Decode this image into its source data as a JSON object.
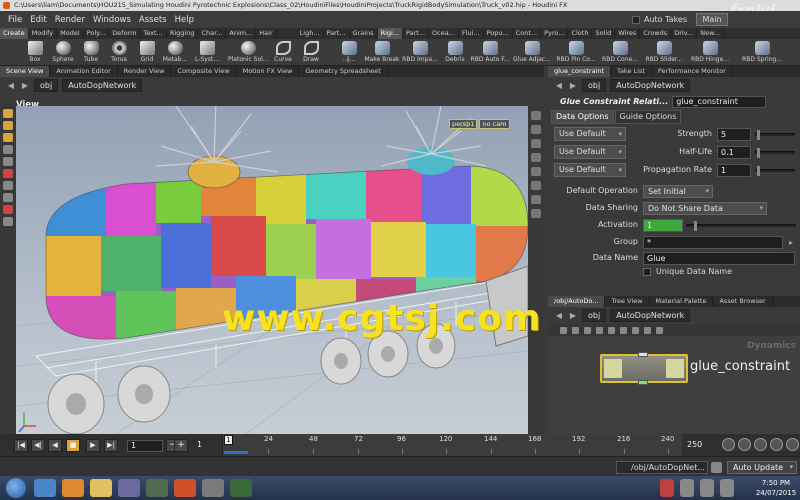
{
  "window": {
    "title": "C:\\Users\\liam\\Documents\\HOU215_Simulating Houdini Pyrotechnic Explosions\\Class_02\\HoudiniFiles\\HoudiniProjects\\TruckRigidBodySimulation\\Truck_v02.hip - Houdini FX",
    "watermark_logo": "fxphd"
  },
  "menubar": {
    "items": [
      "File",
      "Edit",
      "Render",
      "Windows",
      "Assets",
      "Help"
    ],
    "auto_takes": "Auto Takes",
    "desktop": "Main"
  },
  "shelf": {
    "left_tabs": [
      "Create",
      "Modify",
      "Model",
      "Poly...",
      "Deform",
      "Text...",
      "Rigging",
      "Char...",
      "Anim...",
      "Hair"
    ],
    "right_tabs": [
      "Ligh...",
      "Part...",
      "Grains",
      "Rigi...",
      "Part...",
      "Ocea...",
      "Flui...",
      "Popu...",
      "Cont...",
      "Pyro...",
      "Cloth",
      "Solid",
      "Wires",
      "Crowds",
      "Driv...",
      "New..."
    ],
    "left_tools": [
      "Box",
      "Sphere",
      "Tube",
      "Torus",
      "Grid",
      "Metab...",
      "L-Syst...",
      "Platonic Sol...",
      "Curve",
      "Draw"
    ],
    "right_tools": [
      "..ij...",
      "Make Break",
      "RBD Impa...",
      "Debris",
      "RBD Auto F...",
      "Glue Adjac...",
      "RBD Pin Co...",
      "RBD Cone...",
      "RBD Slider...",
      "RBD Hinge...",
      "RBD Spring..."
    ]
  },
  "viewer": {
    "tabs": [
      "Scene View",
      "Animation Editor",
      "Render View",
      "Composite View",
      "Motion FX View",
      "Geometry Spreadsheet"
    ],
    "path": [
      "obj",
      "AutoDopNetwork"
    ],
    "view_name": "View",
    "camera": "persp1",
    "cam_mode": "no cam",
    "watermark": "www.cgtsj.com"
  },
  "params": {
    "tabs": [
      "glue_constraint",
      "Take List",
      "Performance Monitor"
    ],
    "path": [
      "obj",
      "AutoDopNetwork"
    ],
    "node_type": "Glue Constraint Relati...",
    "node_name": "glue_constraint",
    "subtabs": [
      "Data Options",
      "Guide Options"
    ],
    "use_default": "Use Default",
    "strength_label": "Strength",
    "strength": "5",
    "halflife_label": "Half-Life",
    "halflife": "0.1",
    "propagation_label": "Propagation Rate",
    "propagation": "1",
    "default_op_label": "Default Operation",
    "default_op": "Set Initial",
    "data_sharing_label": "Data Sharing",
    "data_sharing": "Do Not Share Data",
    "activation_label": "Activation",
    "activation": "1",
    "group_label": "Group",
    "group": "*",
    "data_name_label": "Data Name",
    "data_name": "Glue",
    "unique_label": "Unique Data Name"
  },
  "network": {
    "tabs": [
      "/obj/AutoDo...",
      "Tree View",
      "Material Palette",
      "Asset Browser"
    ],
    "path": [
      "obj",
      "AutoDopNetwork"
    ],
    "node_label": "glue_constraint",
    "context": "Dynamics"
  },
  "timeline": {
    "start": "1",
    "start2": "1",
    "current": "1",
    "ticks": [
      "24",
      "48",
      "72",
      "96",
      "120",
      "144",
      "168",
      "192",
      "216",
      "240"
    ],
    "end": "250",
    "end2": "250"
  },
  "status": {
    "path": "/obj/AutoDopNet...",
    "update_mode": "Auto Update"
  },
  "taskbar": {
    "time": "7:50 PM",
    "date": "24/07/2015"
  },
  "colors": {
    "accent_node": "#e0c030",
    "activation_green": "#3ea83e",
    "watermark": "#f6e21e"
  }
}
